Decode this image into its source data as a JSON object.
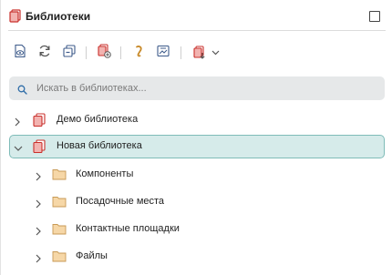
{
  "header": {
    "title": "Библиотеки"
  },
  "toolbar": {
    "buttons": [
      {
        "name": "view-library-button",
        "icon": "document-eye-icon"
      },
      {
        "name": "refresh-button",
        "icon": "refresh-icon"
      },
      {
        "name": "collapse-all-button",
        "icon": "collapse-icon"
      },
      {
        "name": "add-library-button",
        "icon": "add-library-icon"
      },
      {
        "name": "link-button",
        "icon": "link-icon"
      },
      {
        "name": "image-button",
        "icon": "image-frame-icon"
      },
      {
        "name": "export-button",
        "icon": "export-dropdown-icon"
      }
    ]
  },
  "search": {
    "placeholder": "Искать в библиотеках..."
  },
  "tree": {
    "libraries": [
      {
        "label": "Демо библиотека",
        "expanded": false,
        "selected": false
      },
      {
        "label": "Новая библиотека",
        "expanded": true,
        "selected": true,
        "children": [
          {
            "label": "Компоненты"
          },
          {
            "label": "Посадочные места"
          },
          {
            "label": "Контактные площадки"
          },
          {
            "label": "Файлы"
          }
        ]
      }
    ]
  },
  "colors": {
    "accent_red": "#d9534f",
    "folder": "#f6d7a7",
    "selected_bg": "#d6ebea",
    "selected_border": "#7fbcb8",
    "search_bg": "#e6e8e9"
  }
}
